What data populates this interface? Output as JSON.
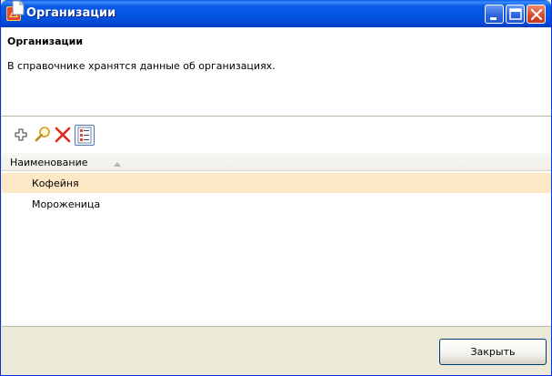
{
  "window": {
    "title": "Организации",
    "icon": "app-logo-icon",
    "controls": [
      "minimize-icon",
      "maximize-icon",
      "close-icon"
    ]
  },
  "header": {
    "title": "Организации",
    "description": "В справочнике хранятся данные об организациях."
  },
  "toolbar": {
    "buttons": [
      "add-icon",
      "search-icon",
      "delete-icon",
      "columns-icon"
    ]
  },
  "grid": {
    "column_header": "Наименование",
    "sort": "ascending",
    "rows": [
      {
        "name": "Кофейня",
        "selected": true
      },
      {
        "name": "Мороженица",
        "selected": false
      }
    ]
  },
  "footer": {
    "close_label": "Закрыть"
  },
  "colors": {
    "titlebar": "#0454e2",
    "selection": "#fde8c6",
    "delete": "#e0281e"
  }
}
